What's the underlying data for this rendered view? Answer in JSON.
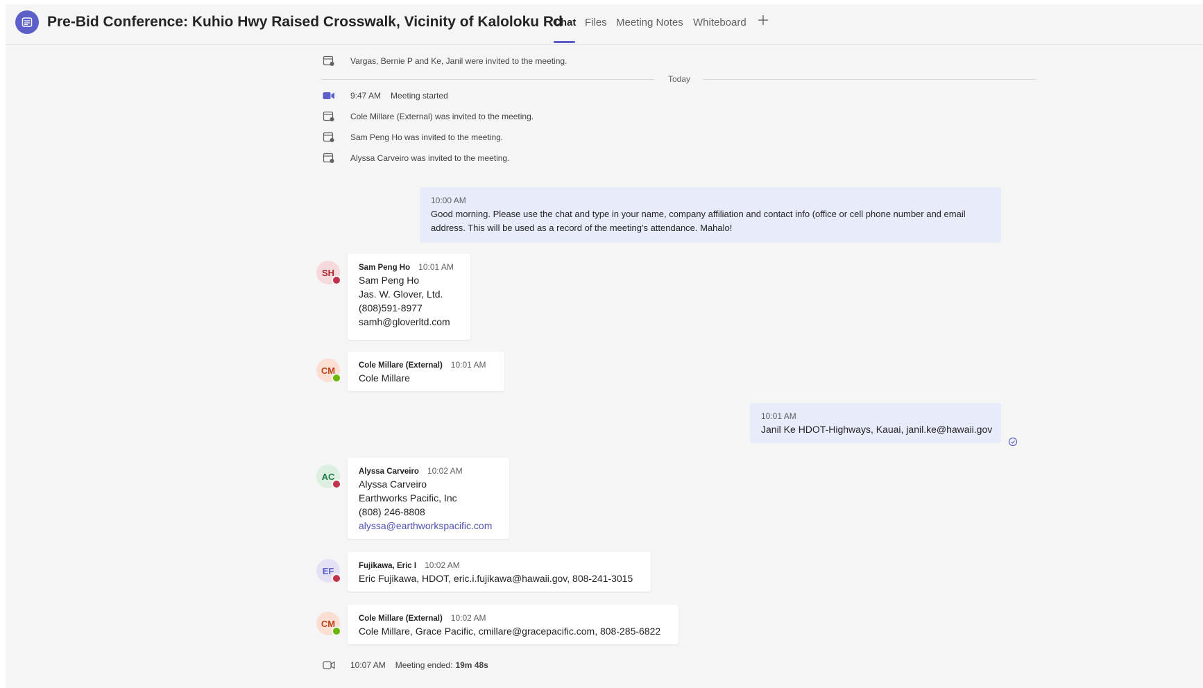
{
  "header": {
    "title": "Pre-Bid Conference: Kuhio Hwy Raised Crosswalk, Vicinity of Kaloloku Rd",
    "tabs": [
      {
        "label": "Chat",
        "active": true
      },
      {
        "label": "Files",
        "active": false
      },
      {
        "label": "Meeting Notes",
        "active": false
      },
      {
        "label": "Whiteboard",
        "active": false
      }
    ],
    "add_tab_icon": "plus-icon"
  },
  "colors": {
    "accent": "#5b5fc7",
    "my_bubble": "#e8ebfa",
    "busy": "#c4314b",
    "available": "#6bb700",
    "link": "#4f52b2"
  },
  "system_messages": [
    {
      "icon": "calendar-invite-icon",
      "text": "Vargas, Bernie P and Ke, Janil were invited to the meeting."
    },
    {
      "icon": "video-camera-icon",
      "time": "9:47 AM",
      "text": "Meeting started"
    },
    {
      "icon": "calendar-invite-icon",
      "text": "Cole Millare (External) was invited to the meeting."
    },
    {
      "icon": "calendar-invite-icon",
      "text": "Sam Peng Ho was invited to the meeting."
    },
    {
      "icon": "calendar-invite-icon",
      "text": "Alyssa Carveiro was invited to the meeting."
    }
  ],
  "divider_label": "Today",
  "messages": [
    {
      "mine": true,
      "time": "10:00 AM",
      "text": "Good morning.  Please use the chat and type in your name, company affiliation and contact info (office or cell phone number and email address.  This will be used as a record of the meeting's attendance.  Mahalo!"
    },
    {
      "initials": "SH",
      "status": "busy",
      "sender": "Sam Peng Ho",
      "time": "10:01 AM",
      "lines": [
        "Sam Peng Ho",
        "Jas. W. Glover, Ltd.",
        "(808)591-8977",
        "samh@gloverltd.com"
      ]
    },
    {
      "initials": "CM",
      "status": "available",
      "sender": "Cole Millare (External)",
      "time": "10:01 AM",
      "lines": [
        "Cole Millare"
      ]
    },
    {
      "mine": true,
      "time": "10:01 AM",
      "text": "Janil Ke HDOT-Highways, Kauai, janil.ke@hawaii.gov",
      "read_icon": "read-receipt-icon"
    },
    {
      "initials": "AC",
      "status": "busy",
      "sender": "Alyssa Carveiro",
      "time": "10:02 AM",
      "lines": [
        "Alyssa Carveiro",
        "Earthworks Pacific, Inc",
        "(808) 246-8808"
      ],
      "link": "alyssa@earthworkspacific.com"
    },
    {
      "initials": "EF",
      "status": "busy",
      "sender": "Fujikawa, Eric I",
      "time": "10:02 AM",
      "lines": [
        "Eric Fujikawa, HDOT, eric.i.fujikawa@hawaii.gov, 808-241-3015"
      ]
    },
    {
      "initials": "CM",
      "status": "available",
      "sender": "Cole Millare (External)",
      "time": "10:02 AM",
      "lines": [
        "Cole Millare, Grace Pacific, cmillare@gracepacific.com, 808-285-6822"
      ]
    }
  ],
  "meeting_ended": {
    "icon": "video-camera-outline-icon",
    "time": "10:07 AM",
    "label": "Meeting ended:",
    "duration": "19m 48s"
  }
}
